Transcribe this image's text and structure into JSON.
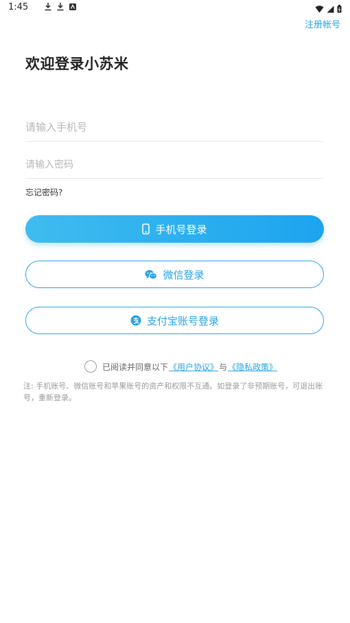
{
  "status_bar": {
    "time": "1:45",
    "left_icons": [
      "download-icon",
      "download-icon",
      "app-notification-icon"
    ],
    "right_icons": [
      "wifi-icon",
      "signal-icon",
      "battery-icon"
    ]
  },
  "header": {
    "register_label": "注册帐号",
    "title": "欢迎登录小苏米"
  },
  "form": {
    "phone_placeholder": "请输入手机号",
    "password_placeholder": "请输入密码",
    "forgot_label": "忘记密码?"
  },
  "buttons": {
    "phone_login_label": "手机号登录",
    "wechat_login_label": "微信登录",
    "alipay_login_label": "支付宝账号登录"
  },
  "agreement": {
    "prefix": "已阅读并同意以下",
    "user_agreement": "《用户协议》",
    "conjunction": "与",
    "privacy_policy": "《隐私政策》"
  },
  "note": "注: 手机账号、微信账号和苹果账号的资产和权限不互通。如登录了非预期账号，可退出账号，重新登录。",
  "colors": {
    "accent": "#26a3e8",
    "button_gradient_start": "#3fbcef",
    "button_gradient_end": "#1da4ef"
  }
}
